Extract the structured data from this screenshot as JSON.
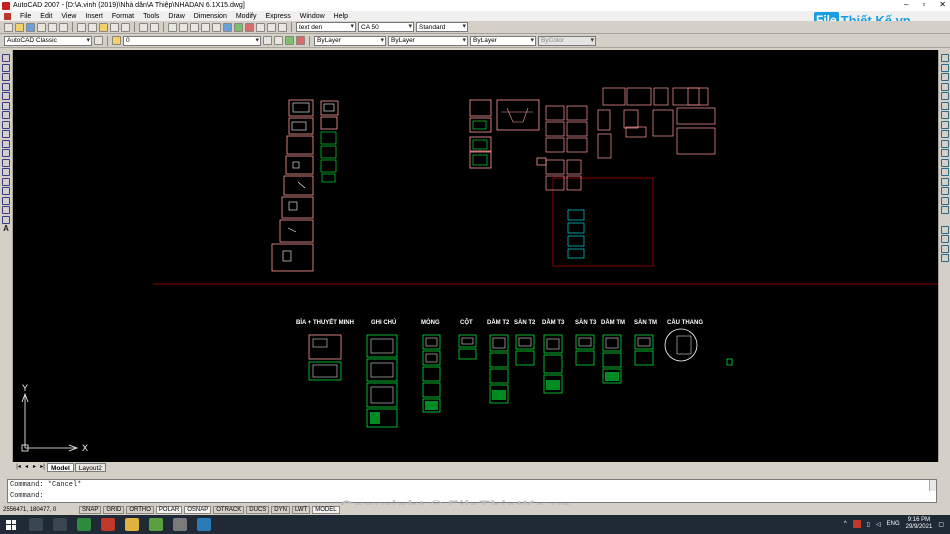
{
  "window": {
    "title": "AutoCAD 2007 - [D:\\A.vinh (2019)\\Nhà dân\\A Thiệp\\NHADAN 6.1X15.dwg]",
    "controls": [
      "–",
      "▫",
      "✕"
    ]
  },
  "menu": [
    "File",
    "Edit",
    "View",
    "Insert",
    "Format",
    "Tools",
    "Draw",
    "Dimension",
    "Modify",
    "Express",
    "Window",
    "Help"
  ],
  "toolbar": {
    "text_style": "text den",
    "dim_style": "CA 50",
    "table_style": "Standard",
    "workspace": "AutoCAD Classic",
    "layer": "0",
    "color": "ByLayer",
    "linetype": "ByLayer",
    "lineweight": "ByLayer",
    "plot_style": "ByColor"
  },
  "canvas": {
    "categories": [
      "BÌA + THUYẾT MINH",
      "GHI CHÚ",
      "MÓNG",
      "CỘT",
      "DẦM T2",
      "SÀN T2",
      "DẦM T3",
      "SÀN T3",
      "DẦM TM",
      "SÀN TM",
      "CẦU THANG"
    ],
    "ucs_x": "X",
    "ucs_y": "Y",
    "colors": {
      "background": "#000000",
      "frame": "#ff9c9c",
      "green": "#00ff3c",
      "red_line": "#b00000"
    }
  },
  "tabs": [
    "Model",
    "Layout2"
  ],
  "command": {
    "line1": "Command: *Cancel*",
    "line2": "Command:"
  },
  "status": {
    "coords": "2556471, 180477, 0",
    "buttons": [
      "SNAP",
      "GRID",
      "ORTHO",
      "POLAR",
      "OSNAP",
      "OTRACK",
      "DUCS",
      "DYN",
      "LWT",
      "MODEL"
    ]
  },
  "taskbar": {
    "lang": "ENG",
    "time": "9:16 PM",
    "date": "29/9/2021"
  },
  "logo": {
    "badge": "File",
    "text": "Thiết Kế.vn"
  },
  "watermark": "Copyright © FileThietKe.vn"
}
